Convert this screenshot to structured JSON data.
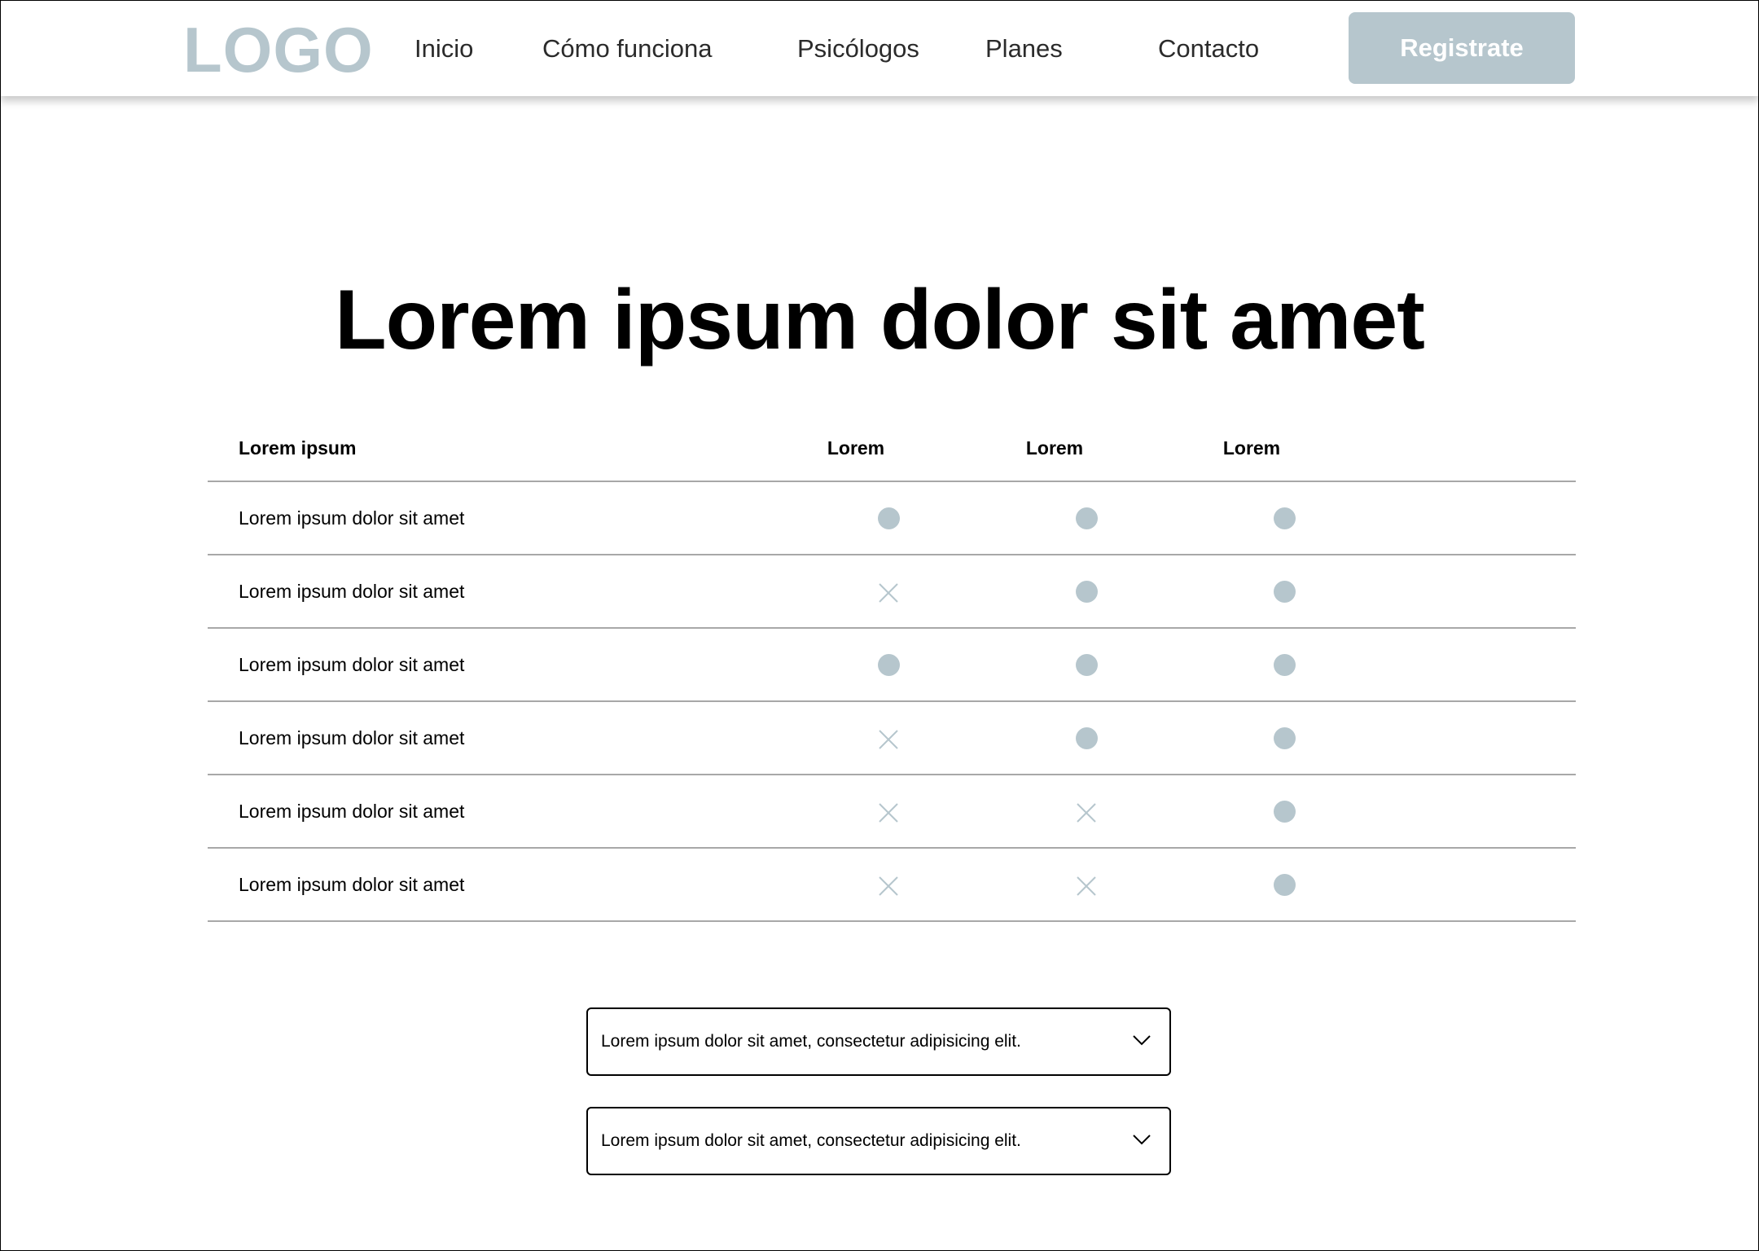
{
  "header": {
    "logo": "LOGO",
    "nav": [
      "Inicio",
      "Cómo funciona",
      "Psicólogos",
      "Planes",
      "Contacto"
    ],
    "register_label": "Registrate"
  },
  "main": {
    "title": "Lorem ipsum dolor sit amet"
  },
  "table": {
    "headers": [
      "Lorem ipsum",
      "Lorem",
      "Lorem",
      "Lorem"
    ],
    "rows": [
      {
        "label": "Lorem ipsum dolor sit amet",
        "values": [
          "dot",
          "dot",
          "dot"
        ]
      },
      {
        "label": "Lorem ipsum dolor sit amet",
        "values": [
          "x",
          "dot",
          "dot"
        ]
      },
      {
        "label": "Lorem ipsum dolor sit amet",
        "values": [
          "dot",
          "dot",
          "dot"
        ]
      },
      {
        "label": "Lorem ipsum dolor sit amet",
        "values": [
          "x",
          "dot",
          "dot"
        ]
      },
      {
        "label": "Lorem ipsum dolor sit amet",
        "values": [
          "x",
          "x",
          "dot"
        ]
      },
      {
        "label": "Lorem ipsum dolor sit amet",
        "values": [
          "x",
          "x",
          "dot"
        ]
      }
    ]
  },
  "faq": [
    {
      "text": "Lorem ipsum dolor sit amet, consectetur adipisicing elit."
    },
    {
      "text": "Lorem ipsum dolor sit amet, consectetur adipisicing elit."
    }
  ],
  "colors": {
    "accent": "#b6c6cd",
    "nav_text": "#2b2b2b",
    "divider": "#a8a8a8"
  },
  "icons": {
    "included": "dot-icon",
    "excluded": "x-mark-icon",
    "dropdown": "chevron-down-icon"
  }
}
